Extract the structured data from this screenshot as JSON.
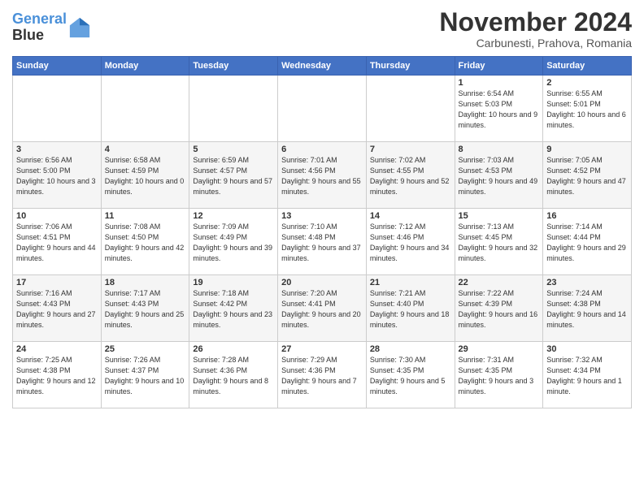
{
  "header": {
    "logo_line1": "General",
    "logo_line2": "Blue",
    "month_title": "November 2024",
    "location": "Carbunesti, Prahova, Romania"
  },
  "days_of_week": [
    "Sunday",
    "Monday",
    "Tuesday",
    "Wednesday",
    "Thursday",
    "Friday",
    "Saturday"
  ],
  "weeks": [
    [
      {
        "day": "",
        "info": ""
      },
      {
        "day": "",
        "info": ""
      },
      {
        "day": "",
        "info": ""
      },
      {
        "day": "",
        "info": ""
      },
      {
        "day": "",
        "info": ""
      },
      {
        "day": "1",
        "info": "Sunrise: 6:54 AM\nSunset: 5:03 PM\nDaylight: 10 hours and 9 minutes."
      },
      {
        "day": "2",
        "info": "Sunrise: 6:55 AM\nSunset: 5:01 PM\nDaylight: 10 hours and 6 minutes."
      }
    ],
    [
      {
        "day": "3",
        "info": "Sunrise: 6:56 AM\nSunset: 5:00 PM\nDaylight: 10 hours and 3 minutes."
      },
      {
        "day": "4",
        "info": "Sunrise: 6:58 AM\nSunset: 4:59 PM\nDaylight: 10 hours and 0 minutes."
      },
      {
        "day": "5",
        "info": "Sunrise: 6:59 AM\nSunset: 4:57 PM\nDaylight: 9 hours and 57 minutes."
      },
      {
        "day": "6",
        "info": "Sunrise: 7:01 AM\nSunset: 4:56 PM\nDaylight: 9 hours and 55 minutes."
      },
      {
        "day": "7",
        "info": "Sunrise: 7:02 AM\nSunset: 4:55 PM\nDaylight: 9 hours and 52 minutes."
      },
      {
        "day": "8",
        "info": "Sunrise: 7:03 AM\nSunset: 4:53 PM\nDaylight: 9 hours and 49 minutes."
      },
      {
        "day": "9",
        "info": "Sunrise: 7:05 AM\nSunset: 4:52 PM\nDaylight: 9 hours and 47 minutes."
      }
    ],
    [
      {
        "day": "10",
        "info": "Sunrise: 7:06 AM\nSunset: 4:51 PM\nDaylight: 9 hours and 44 minutes."
      },
      {
        "day": "11",
        "info": "Sunrise: 7:08 AM\nSunset: 4:50 PM\nDaylight: 9 hours and 42 minutes."
      },
      {
        "day": "12",
        "info": "Sunrise: 7:09 AM\nSunset: 4:49 PM\nDaylight: 9 hours and 39 minutes."
      },
      {
        "day": "13",
        "info": "Sunrise: 7:10 AM\nSunset: 4:48 PM\nDaylight: 9 hours and 37 minutes."
      },
      {
        "day": "14",
        "info": "Sunrise: 7:12 AM\nSunset: 4:46 PM\nDaylight: 9 hours and 34 minutes."
      },
      {
        "day": "15",
        "info": "Sunrise: 7:13 AM\nSunset: 4:45 PM\nDaylight: 9 hours and 32 minutes."
      },
      {
        "day": "16",
        "info": "Sunrise: 7:14 AM\nSunset: 4:44 PM\nDaylight: 9 hours and 29 minutes."
      }
    ],
    [
      {
        "day": "17",
        "info": "Sunrise: 7:16 AM\nSunset: 4:43 PM\nDaylight: 9 hours and 27 minutes."
      },
      {
        "day": "18",
        "info": "Sunrise: 7:17 AM\nSunset: 4:43 PM\nDaylight: 9 hours and 25 minutes."
      },
      {
        "day": "19",
        "info": "Sunrise: 7:18 AM\nSunset: 4:42 PM\nDaylight: 9 hours and 23 minutes."
      },
      {
        "day": "20",
        "info": "Sunrise: 7:20 AM\nSunset: 4:41 PM\nDaylight: 9 hours and 20 minutes."
      },
      {
        "day": "21",
        "info": "Sunrise: 7:21 AM\nSunset: 4:40 PM\nDaylight: 9 hours and 18 minutes."
      },
      {
        "day": "22",
        "info": "Sunrise: 7:22 AM\nSunset: 4:39 PM\nDaylight: 9 hours and 16 minutes."
      },
      {
        "day": "23",
        "info": "Sunrise: 7:24 AM\nSunset: 4:38 PM\nDaylight: 9 hours and 14 minutes."
      }
    ],
    [
      {
        "day": "24",
        "info": "Sunrise: 7:25 AM\nSunset: 4:38 PM\nDaylight: 9 hours and 12 minutes."
      },
      {
        "day": "25",
        "info": "Sunrise: 7:26 AM\nSunset: 4:37 PM\nDaylight: 9 hours and 10 minutes."
      },
      {
        "day": "26",
        "info": "Sunrise: 7:28 AM\nSunset: 4:36 PM\nDaylight: 9 hours and 8 minutes."
      },
      {
        "day": "27",
        "info": "Sunrise: 7:29 AM\nSunset: 4:36 PM\nDaylight: 9 hours and 7 minutes."
      },
      {
        "day": "28",
        "info": "Sunrise: 7:30 AM\nSunset: 4:35 PM\nDaylight: 9 hours and 5 minutes."
      },
      {
        "day": "29",
        "info": "Sunrise: 7:31 AM\nSunset: 4:35 PM\nDaylight: 9 hours and 3 minutes."
      },
      {
        "day": "30",
        "info": "Sunrise: 7:32 AM\nSunset: 4:34 PM\nDaylight: 9 hours and 1 minute."
      }
    ]
  ]
}
